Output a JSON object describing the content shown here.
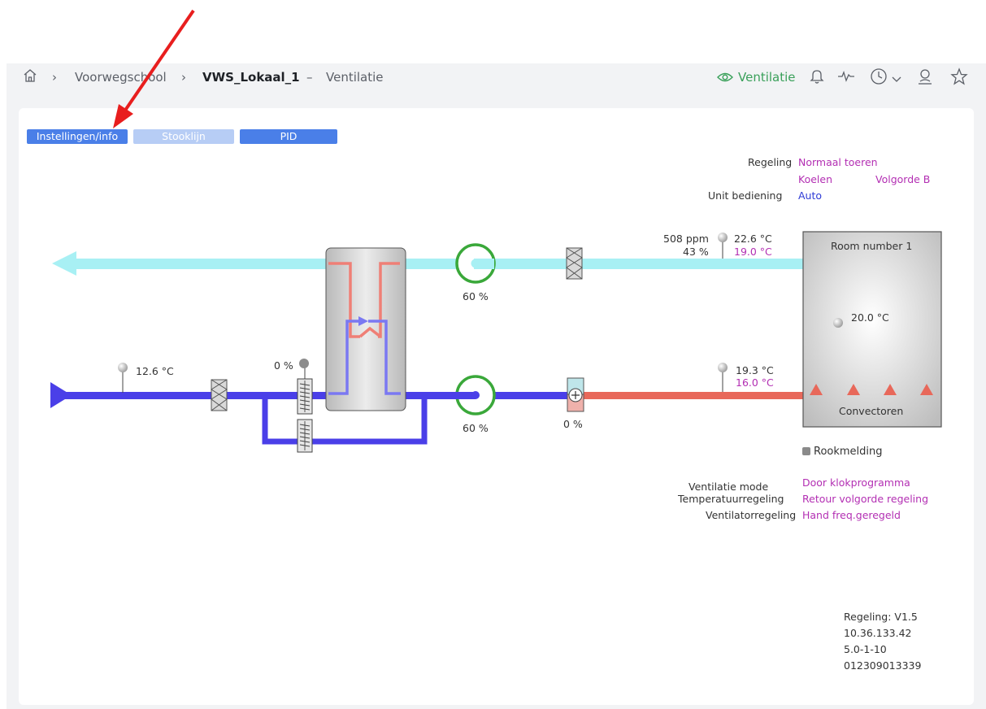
{
  "breadcrumb": {
    "home_icon": "home-icon",
    "item1": "Voorwegschool",
    "item2": "VWS_Lokaal_1",
    "separator_dash": "–",
    "item3": "Ventilatie"
  },
  "header": {
    "view_mode_label": "Ventilatie",
    "icons": [
      "eye-icon",
      "bell-icon",
      "pulse-icon",
      "clock-icon",
      "chevron-down-icon",
      "user-icon",
      "star-icon"
    ],
    "accent_color": "#3aa05a"
  },
  "tabs": [
    {
      "label": "Instellingen/info",
      "color": "#4a7fe8"
    },
    {
      "label": "Stooklijn",
      "color": "#b7cdf5"
    },
    {
      "label": "PID",
      "color": "#4a7fe8"
    }
  ],
  "status": {
    "regeling_label": "Regeling",
    "regeling_value": "Normaal toeren",
    "koelen": "Koelen",
    "volgorde": "Volgorde B",
    "unit_bediening_label": "Unit bediening",
    "unit_bediening_value": "Auto"
  },
  "sensors": {
    "return_ppm": "508 ppm",
    "return_rh": "43 %",
    "return_temp": "22.6 °C",
    "return_setpoint": "19.0 °C",
    "outside_temp": "12.6 °C",
    "valve_pct": "0 %",
    "supply_temp": "19.3 °C",
    "supply_setpoint": "16.0 °C",
    "heater_pct": "0 %",
    "exhaust_fan_pct": "60 %",
    "supply_fan_pct": "60 %"
  },
  "room": {
    "title": "Room number  1",
    "temp": "20.0 °C",
    "convectors_label": "Convectoren"
  },
  "smoke": {
    "label": "Rookmelding"
  },
  "modes": {
    "ventilatie_mode_label": "Ventilatie mode",
    "ventilatie_mode_value": "Door klokprogramma",
    "temperatuur_label": "Temperatuurregeling",
    "temperatuur_value": "Retour volgorde regeling",
    "ventilator_label": "Ventilatorregeling",
    "ventilator_value": "Hand freq.geregeld"
  },
  "info": {
    "version": "Regeling: V1.5",
    "ip": "10.36.133.42",
    "build": "5.0-1-10",
    "serial": "012309013339"
  },
  "colors": {
    "exhaust_duct": "#a8f0f4",
    "supply_duct": "#4a3fe8",
    "heated_duct": "#e8685a",
    "fan": "#3aa83a",
    "label_purple": "#b32fb3",
    "label_orange": "#e08a1c",
    "annotation_arrow": "#e81e1e"
  }
}
